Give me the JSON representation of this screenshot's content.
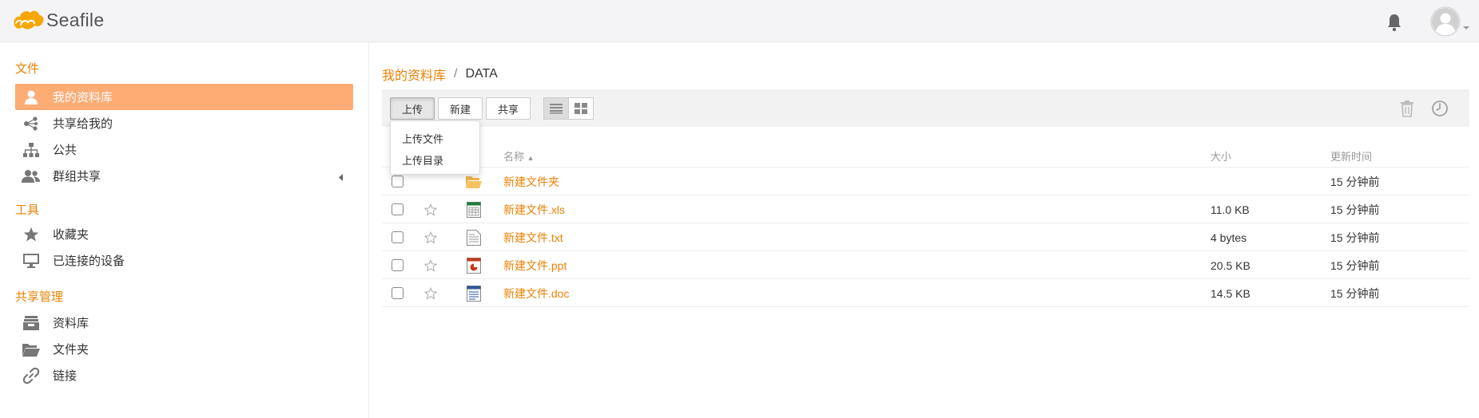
{
  "header": {
    "logo_text": "Seafile",
    "notification_icon": "bell-icon",
    "avatar_icon": "user-avatar-icon"
  },
  "sidebar": {
    "sections": [
      {
        "heading": "文件",
        "items": [
          {
            "label": "我的资料库",
            "icon": "user-icon",
            "active": true
          },
          {
            "label": "共享给我的",
            "icon": "share-icon",
            "active": false
          },
          {
            "label": "公共",
            "icon": "org-chart-icon",
            "active": false
          },
          {
            "label": "群组共享",
            "icon": "group-icon",
            "active": false
          }
        ]
      },
      {
        "heading": "工具",
        "items": [
          {
            "label": "收藏夹",
            "icon": "star-icon",
            "active": false
          },
          {
            "label": "已连接的设备",
            "icon": "monitor-icon",
            "active": false
          }
        ]
      },
      {
        "heading": "共享管理",
        "items": [
          {
            "label": "资料库",
            "icon": "library-icon",
            "active": false
          },
          {
            "label": "文件夹",
            "icon": "folder-open-icon",
            "active": false
          },
          {
            "label": "链接",
            "icon": "link-icon",
            "active": false
          }
        ]
      }
    ]
  },
  "breadcrumb": {
    "root": "我的资料库",
    "separator": "/",
    "current": "DATA"
  },
  "toolbar": {
    "upload_label": "上传",
    "new_label": "新建",
    "share_label": "共享",
    "list_view_icon": "list-view-icon",
    "grid_view_icon": "grid-view-icon",
    "trash_icon": "trash-icon",
    "history_icon": "history-clock-icon"
  },
  "upload_menu": {
    "items": [
      "上传文件",
      "上传目录"
    ]
  },
  "table": {
    "headers": {
      "name": "名称",
      "size": "大小",
      "mtime": "更新时间"
    },
    "sort_indicator": "▲",
    "rows": [
      {
        "name": "新建文件夹",
        "type": "folder",
        "size": "",
        "mtime": "15 分钟前",
        "icon": "folder-icon"
      },
      {
        "name": "新建文件.xls",
        "type": "xls",
        "size": "11.0 KB",
        "mtime": "15 分钟前",
        "icon": "excel-file-icon"
      },
      {
        "name": "新建文件.txt",
        "type": "txt",
        "size": "4 bytes",
        "mtime": "15 分钟前",
        "icon": "text-file-icon"
      },
      {
        "name": "新建文件.ppt",
        "type": "ppt",
        "size": "20.5 KB",
        "mtime": "15 分钟前",
        "icon": "powerpoint-file-icon"
      },
      {
        "name": "新建文件.doc",
        "type": "doc",
        "size": "14.5 KB",
        "mtime": "15 分钟前",
        "icon": "word-file-icon"
      }
    ]
  },
  "colors": {
    "accent": "#eb8205",
    "active_nav_bg": "#feac74",
    "header_bg": "#f4f4f7"
  }
}
